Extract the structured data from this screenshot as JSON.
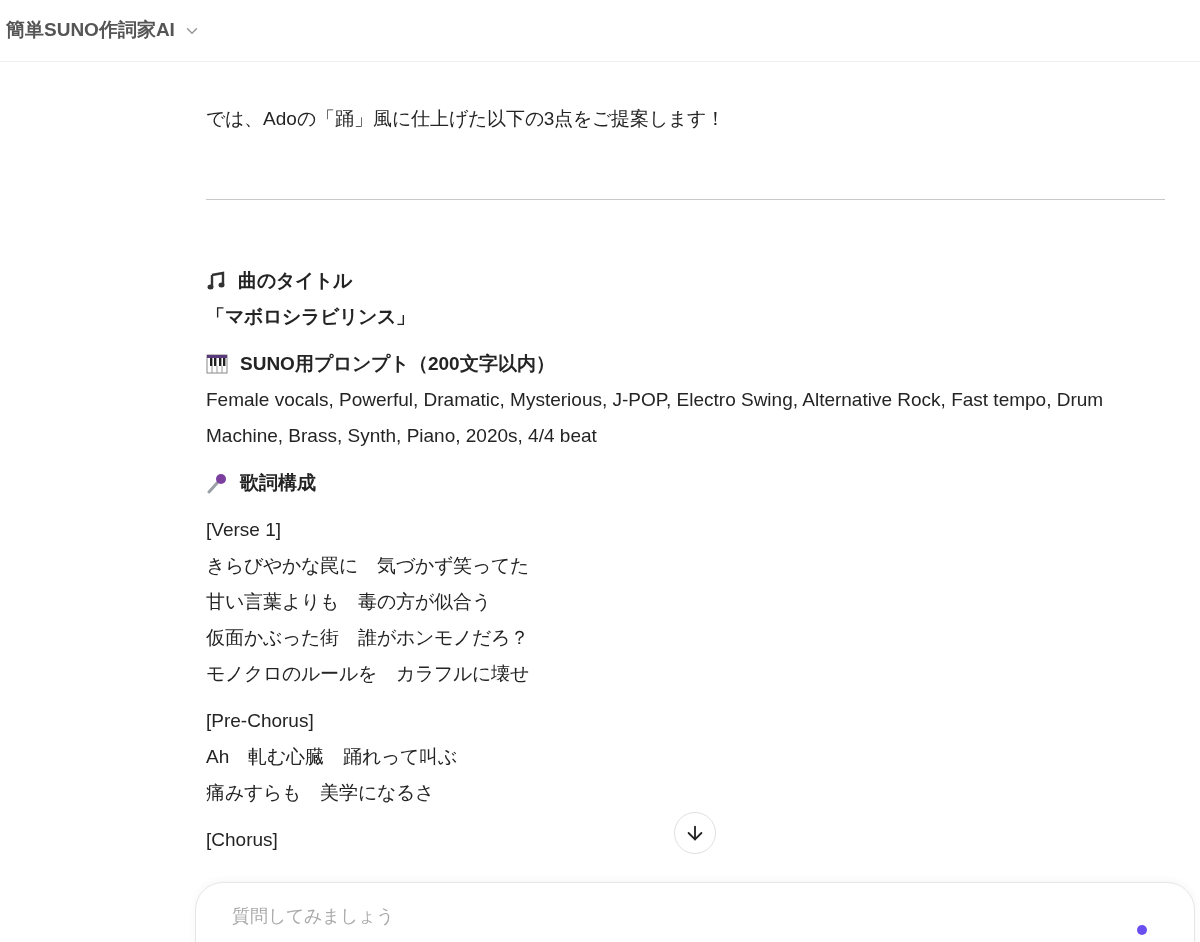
{
  "header": {
    "title": "簡単SUNO作詞家AI"
  },
  "intro": "では、Adoの「踊」風に仕上げた以下の3点をご提案します！",
  "song_title": {
    "heading": "曲のタイトル",
    "value": "「マボロシラビリンス」"
  },
  "prompt": {
    "heading": "SUNO用プロンプト（200文字以内）",
    "value": "Female vocals, Powerful, Dramatic, Mysterious, J-POP, Electro Swing, Alternative Rock, Fast tempo, Drum Machine, Brass, Synth, Piano, 2020s, 4/4 beat"
  },
  "lyrics": {
    "heading": "歌詞構成",
    "stanzas": [
      {
        "label": "[Verse 1]",
        "lines": [
          "きらびやかな罠に　気づかず笑ってた",
          "甘い言葉よりも　毒の方が似合う",
          "仮面かぶった街　誰がホンモノだろ？",
          "モノクロのルールを　カラフルに壊せ"
        ]
      },
      {
        "label": "[Pre-Chorus]",
        "lines": [
          "Ah　軋む心臓　踊れって叫ぶ",
          "痛みすらも　美学になるさ"
        ]
      },
      {
        "label": "[Chorus]"
      }
    ]
  },
  "composer": {
    "placeholder": "質問してみましょう"
  }
}
